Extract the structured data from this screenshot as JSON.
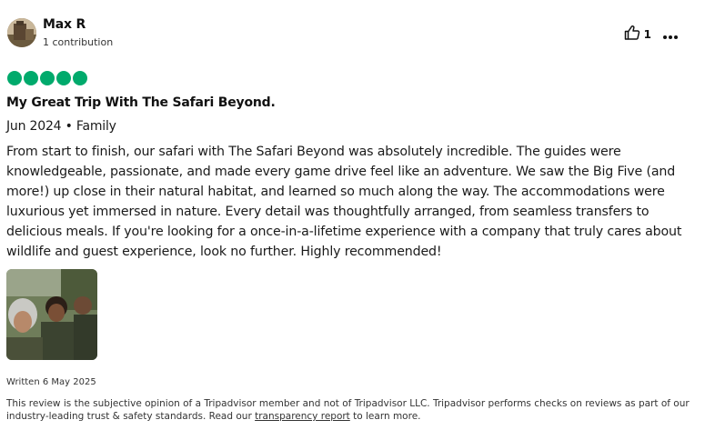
{
  "review": {
    "author": {
      "name": "Max R",
      "contributions": "1 contribution"
    },
    "helpful_count": "1",
    "rating": 5,
    "rating_color": "#00aa6c",
    "title": "My Great Trip With The Safari Beyond.",
    "meta": "Jun 2024 • Family",
    "body": "From start to finish, our safari with The Safari Beyond was absolutely incredible. The guides were knowledgeable, passionate, and made every game drive feel like an adventure. We saw the Big Five (and more!) up close in their natural habitat, and learned so much along the way. The accommodations were luxurious yet immersed in nature. Every detail was thoughtfully arranged, from seamless transfers to delicious meals. If you're looking for a once-in-a-lifetime experience with a company that truly cares about wildlife and guest experience, look no further. Highly recommended!",
    "written": "Written 6 May 2025",
    "disclaimer_before": "This review is the subjective opinion of a Tripadvisor member and not of Tripadvisor LLC. Tripadvisor performs checks on reviews as part of our industry-leading trust & safety standards. Read our ",
    "disclaimer_link": "transparency report",
    "disclaimer_after": " to learn more."
  },
  "icons": {
    "like": "thumbs-up-icon",
    "more": "more-horizontal-icon"
  }
}
